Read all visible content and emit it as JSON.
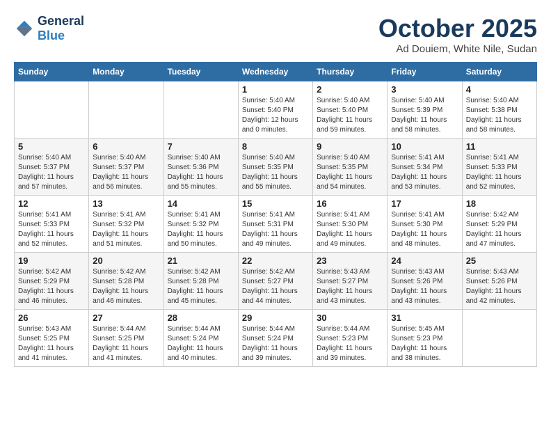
{
  "header": {
    "logo_line1": "General",
    "logo_line2": "Blue",
    "month_title": "October 2025",
    "subtitle": "Ad Douiem, White Nile, Sudan"
  },
  "days_of_week": [
    "Sunday",
    "Monday",
    "Tuesday",
    "Wednesday",
    "Thursday",
    "Friday",
    "Saturday"
  ],
  "weeks": [
    [
      {
        "day": "",
        "info": ""
      },
      {
        "day": "",
        "info": ""
      },
      {
        "day": "",
        "info": ""
      },
      {
        "day": "1",
        "info": "Sunrise: 5:40 AM\nSunset: 5:40 PM\nDaylight: 12 hours\nand 0 minutes."
      },
      {
        "day": "2",
        "info": "Sunrise: 5:40 AM\nSunset: 5:40 PM\nDaylight: 11 hours\nand 59 minutes."
      },
      {
        "day": "3",
        "info": "Sunrise: 5:40 AM\nSunset: 5:39 PM\nDaylight: 11 hours\nand 58 minutes."
      },
      {
        "day": "4",
        "info": "Sunrise: 5:40 AM\nSunset: 5:38 PM\nDaylight: 11 hours\nand 58 minutes."
      }
    ],
    [
      {
        "day": "5",
        "info": "Sunrise: 5:40 AM\nSunset: 5:37 PM\nDaylight: 11 hours\nand 57 minutes."
      },
      {
        "day": "6",
        "info": "Sunrise: 5:40 AM\nSunset: 5:37 PM\nDaylight: 11 hours\nand 56 minutes."
      },
      {
        "day": "7",
        "info": "Sunrise: 5:40 AM\nSunset: 5:36 PM\nDaylight: 11 hours\nand 55 minutes."
      },
      {
        "day": "8",
        "info": "Sunrise: 5:40 AM\nSunset: 5:35 PM\nDaylight: 11 hours\nand 55 minutes."
      },
      {
        "day": "9",
        "info": "Sunrise: 5:40 AM\nSunset: 5:35 PM\nDaylight: 11 hours\nand 54 minutes."
      },
      {
        "day": "10",
        "info": "Sunrise: 5:41 AM\nSunset: 5:34 PM\nDaylight: 11 hours\nand 53 minutes."
      },
      {
        "day": "11",
        "info": "Sunrise: 5:41 AM\nSunset: 5:33 PM\nDaylight: 11 hours\nand 52 minutes."
      }
    ],
    [
      {
        "day": "12",
        "info": "Sunrise: 5:41 AM\nSunset: 5:33 PM\nDaylight: 11 hours\nand 52 minutes."
      },
      {
        "day": "13",
        "info": "Sunrise: 5:41 AM\nSunset: 5:32 PM\nDaylight: 11 hours\nand 51 minutes."
      },
      {
        "day": "14",
        "info": "Sunrise: 5:41 AM\nSunset: 5:32 PM\nDaylight: 11 hours\nand 50 minutes."
      },
      {
        "day": "15",
        "info": "Sunrise: 5:41 AM\nSunset: 5:31 PM\nDaylight: 11 hours\nand 49 minutes."
      },
      {
        "day": "16",
        "info": "Sunrise: 5:41 AM\nSunset: 5:30 PM\nDaylight: 11 hours\nand 49 minutes."
      },
      {
        "day": "17",
        "info": "Sunrise: 5:41 AM\nSunset: 5:30 PM\nDaylight: 11 hours\nand 48 minutes."
      },
      {
        "day": "18",
        "info": "Sunrise: 5:42 AM\nSunset: 5:29 PM\nDaylight: 11 hours\nand 47 minutes."
      }
    ],
    [
      {
        "day": "19",
        "info": "Sunrise: 5:42 AM\nSunset: 5:29 PM\nDaylight: 11 hours\nand 46 minutes."
      },
      {
        "day": "20",
        "info": "Sunrise: 5:42 AM\nSunset: 5:28 PM\nDaylight: 11 hours\nand 46 minutes."
      },
      {
        "day": "21",
        "info": "Sunrise: 5:42 AM\nSunset: 5:28 PM\nDaylight: 11 hours\nand 45 minutes."
      },
      {
        "day": "22",
        "info": "Sunrise: 5:42 AM\nSunset: 5:27 PM\nDaylight: 11 hours\nand 44 minutes."
      },
      {
        "day": "23",
        "info": "Sunrise: 5:43 AM\nSunset: 5:27 PM\nDaylight: 11 hours\nand 43 minutes."
      },
      {
        "day": "24",
        "info": "Sunrise: 5:43 AM\nSunset: 5:26 PM\nDaylight: 11 hours\nand 43 minutes."
      },
      {
        "day": "25",
        "info": "Sunrise: 5:43 AM\nSunset: 5:26 PM\nDaylight: 11 hours\nand 42 minutes."
      }
    ],
    [
      {
        "day": "26",
        "info": "Sunrise: 5:43 AM\nSunset: 5:25 PM\nDaylight: 11 hours\nand 41 minutes."
      },
      {
        "day": "27",
        "info": "Sunrise: 5:44 AM\nSunset: 5:25 PM\nDaylight: 11 hours\nand 41 minutes."
      },
      {
        "day": "28",
        "info": "Sunrise: 5:44 AM\nSunset: 5:24 PM\nDaylight: 11 hours\nand 40 minutes."
      },
      {
        "day": "29",
        "info": "Sunrise: 5:44 AM\nSunset: 5:24 PM\nDaylight: 11 hours\nand 39 minutes."
      },
      {
        "day": "30",
        "info": "Sunrise: 5:44 AM\nSunset: 5:23 PM\nDaylight: 11 hours\nand 39 minutes."
      },
      {
        "day": "31",
        "info": "Sunrise: 5:45 AM\nSunset: 5:23 PM\nDaylight: 11 hours\nand 38 minutes."
      },
      {
        "day": "",
        "info": ""
      }
    ]
  ]
}
